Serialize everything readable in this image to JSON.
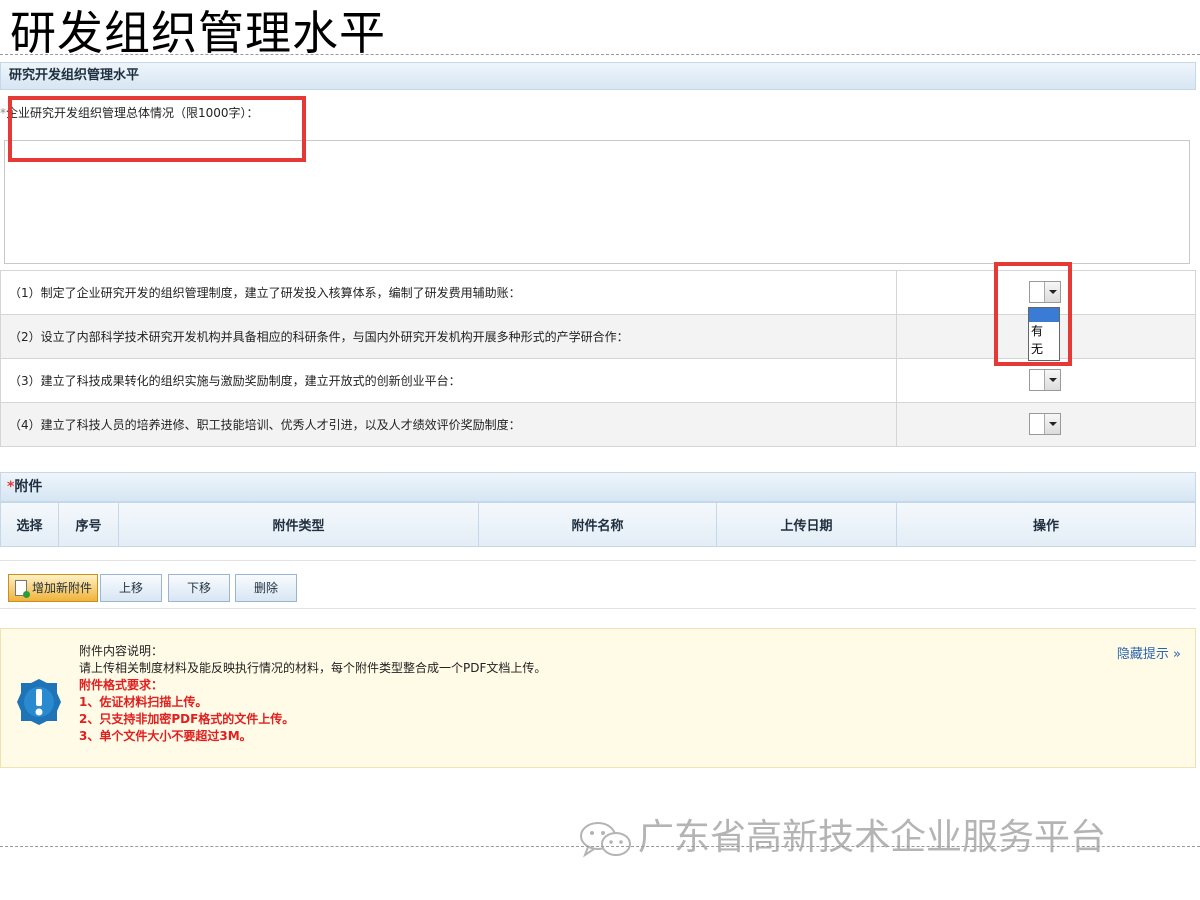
{
  "slide_title": "研发组织管理水平",
  "section1": {
    "header": "研究开发组织管理水平",
    "summary_prefix": "*",
    "summary_label": "企业研究开发组织管理总体情况（限1000字）：",
    "summary_value": ""
  },
  "questions": [
    {
      "text": "（1）制定了企业研究开发的组织管理制度，建立了研发投入核算体系，编制了研发费用辅助账：",
      "value": ""
    },
    {
      "text": "（2）设立了内部科学技术研究开发机构并具备相应的科研条件，与国内外研究开发机构开展多种形式的产学研合作：",
      "value": ""
    },
    {
      "text": "（3）建立了科技成果转化的组织实施与激励奖励制度，建立开放式的创新创业平台：",
      "value": ""
    },
    {
      "text": "（4）建立了科技人员的培养进修、职工技能培训、优秀人才引进，以及人才绩效评价奖励制度：",
      "value": ""
    }
  ],
  "dropdown_options": [
    "有",
    "无"
  ],
  "attachments": {
    "required_mark": "*",
    "header": "附件",
    "columns": [
      "选择",
      "序号",
      "附件类型",
      "附件名称",
      "上传日期",
      "操作"
    ],
    "buttons": {
      "add": "增加新附件",
      "up": "上移",
      "down": "下移",
      "delete": "删除"
    }
  },
  "notice": {
    "hide_link": "隐藏提示 »",
    "title": "附件内容说明：",
    "desc": "请上传相关制度材料及能反映执行情况的材料，每个附件类型整合成一个PDF文档上传。",
    "format_title": "附件格式要求：",
    "rule1": "1、佐证材料扫描上传。",
    "rule2": "2、只支持非加密PDF格式的文件上传。",
    "rule3": "3、单个文件大小不要超过3M。"
  },
  "watermark": "广东省高新技术企业服务平台",
  "colors": {
    "header_bg": "#d6e6f3",
    "highlight_red": "#e53935",
    "notice_bg": "#fffbe6",
    "required_red": "#e02020",
    "link_blue": "#2a64b0"
  },
  "icons": {
    "select_arrow": "chevron-down-icon",
    "add_attachment": "document-add-icon",
    "notice": "exclamation-gear-icon",
    "watermark": "wechat-icon"
  }
}
